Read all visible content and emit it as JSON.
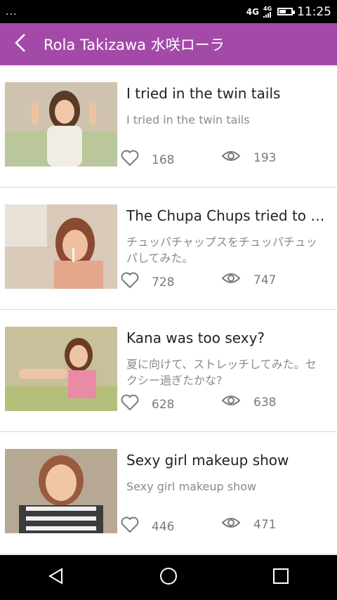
{
  "status_bar": {
    "left_indicator": "...",
    "network_primary": "4G",
    "network_secondary": "4G",
    "battery_level": 0.55,
    "time": "11:25"
  },
  "app_bar": {
    "title": "Rola Takizawa 水咲ローラ",
    "back_icon": "chevron-left-icon",
    "background": "#a34aa9"
  },
  "videos": [
    {
      "title": "I tried in the twin tails",
      "description": "I tried in the twin tails",
      "likes": "168",
      "views": "193"
    },
    {
      "title": "The Chupa Chups tried to C...",
      "description": "チュッパチャップスをチュッパチュッパしてみた。",
      "likes": "728",
      "views": "747"
    },
    {
      "title": "Kana was too sexy?",
      "description": "夏に向けて、ストレッチしてみた。セクシー過ぎたかな?",
      "likes": "628",
      "views": "638"
    },
    {
      "title": "Sexy girl makeup show",
      "description": "Sexy girl makeup show",
      "likes": "446",
      "views": "471"
    }
  ],
  "icons": {
    "like": "heart-icon",
    "views": "eye-icon"
  },
  "nav_bar": {
    "back": "nav-back-icon",
    "home": "nav-home-icon",
    "recents": "nav-recents-icon"
  }
}
